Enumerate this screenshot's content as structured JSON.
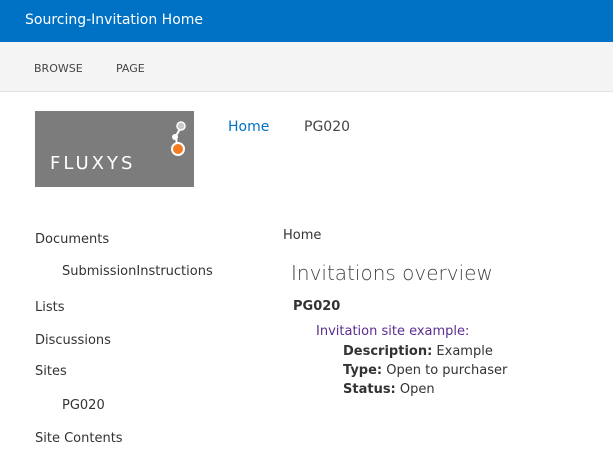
{
  "topbar": {
    "title": "Sourcing-Invitation Home"
  },
  "ribbon": {
    "tabs": [
      "BROWSE",
      "PAGE"
    ]
  },
  "logo": {
    "text": "FLUXYS"
  },
  "breadcrumb": {
    "home": "Home",
    "current": "PG020"
  },
  "quick_launch": {
    "items": [
      {
        "label": "Documents"
      },
      {
        "label": "SubmissionInstructions"
      },
      {
        "label": "Lists"
      },
      {
        "label": "Discussions"
      },
      {
        "label": "Sites"
      },
      {
        "label": "PG020"
      },
      {
        "label": "Site Contents"
      }
    ]
  },
  "main": {
    "crumb": "Home",
    "heading": "Invitations overview",
    "code": "PG020",
    "link": "Invitation site example:",
    "description_label": "Description:",
    "description_value": "Example",
    "type_label": "Type:",
    "type_value": "Open to purchaser",
    "status_label": "Status:",
    "status_value": "Open"
  },
  "colors": {
    "suite_bar": "#0072c6",
    "link": "#0072c6",
    "visited_link": "#5c2d91",
    "logo_bg": "#7c7c7c",
    "logo_accent": "#f47b20"
  }
}
